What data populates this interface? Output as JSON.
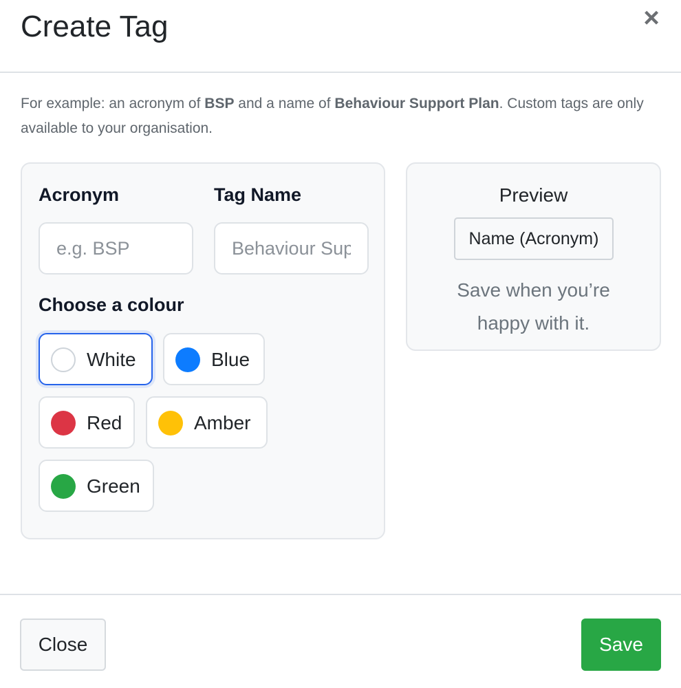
{
  "header": {
    "title": "Create Tag",
    "close_icon": "×"
  },
  "intro": {
    "prefix": "For example: an acronym of ",
    "acronym_example": "BSP",
    "middle": " and a name of ",
    "name_example": "Behaviour Support Plan",
    "suffix": ". Custom tags are only available to your organisation."
  },
  "form": {
    "acronym_label": "Acronym",
    "acronym_value": "",
    "acronym_placeholder": "e.g. BSP",
    "tagname_label": "Tag Name",
    "tagname_value": "",
    "tagname_placeholder": "Behaviour Support Plan",
    "colour_label": "Choose a colour",
    "colours": [
      {
        "label": "White",
        "hex": "#ffffff",
        "selected": true
      },
      {
        "label": "Blue",
        "hex": "#0d7cff",
        "selected": false
      },
      {
        "label": "Red",
        "hex": "#dc3545",
        "selected": false
      },
      {
        "label": "Amber",
        "hex": "#ffc107",
        "selected": false
      },
      {
        "label": "Green",
        "hex": "#28a745",
        "selected": false
      }
    ]
  },
  "preview": {
    "title": "Preview",
    "tag_text": "Name (Acronym)",
    "note_line1": "Save when you’re",
    "note_line2": "happy with it."
  },
  "footer": {
    "close_label": "Close",
    "save_label": "Save"
  },
  "colors": {
    "accent_selected": "#2563eb",
    "save_button": "#28a745"
  }
}
